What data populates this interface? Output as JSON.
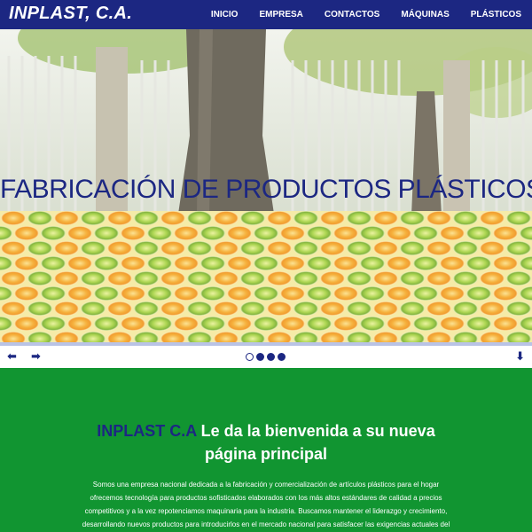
{
  "header": {
    "brand": "INPLAST, C.A.",
    "nav": [
      {
        "label": "INICIO"
      },
      {
        "label": "EMPRESA"
      },
      {
        "label": "CONTACTOS"
      },
      {
        "label": "MÁQUINAS"
      },
      {
        "label": "PLÁSTICOS"
      }
    ],
    "background_color": "#1c2782"
  },
  "hero": {
    "title": "FABRICACIÓN DE PRODUCTOS PLÁSTICOS",
    "title_color": "#1c2782"
  },
  "slider": {
    "prev_icon": "arrow-left-icon",
    "next_icon": "arrow-right-icon",
    "down_icon": "arrow-down-icon",
    "prev_glyph": "⬅",
    "next_glyph": "➡",
    "down_glyph": "⬇",
    "slide_count": 4,
    "active_slide": 1
  },
  "welcome": {
    "brand_name": "INPLAST C.A",
    "heading_rest_line1": " Le da la bienvenida a su nueva",
    "heading_line2": "página principal",
    "body": "Somos una empresa nacional dedicada a la fabricación y comercialización de artículos plásticos para el hogar ofrecemos tecnología para productos sofisticados elaborados con los más altos estándares de calidad a precios competitivos y a la vez repotenciamos maquinaria para la industria. Buscamos mantener el liderazgo y crecimiento, desarrollando nuevos productos para introducirlos en el mercado nacional para satisfacer las exigencias actuales del",
    "background_color": "#119531"
  }
}
